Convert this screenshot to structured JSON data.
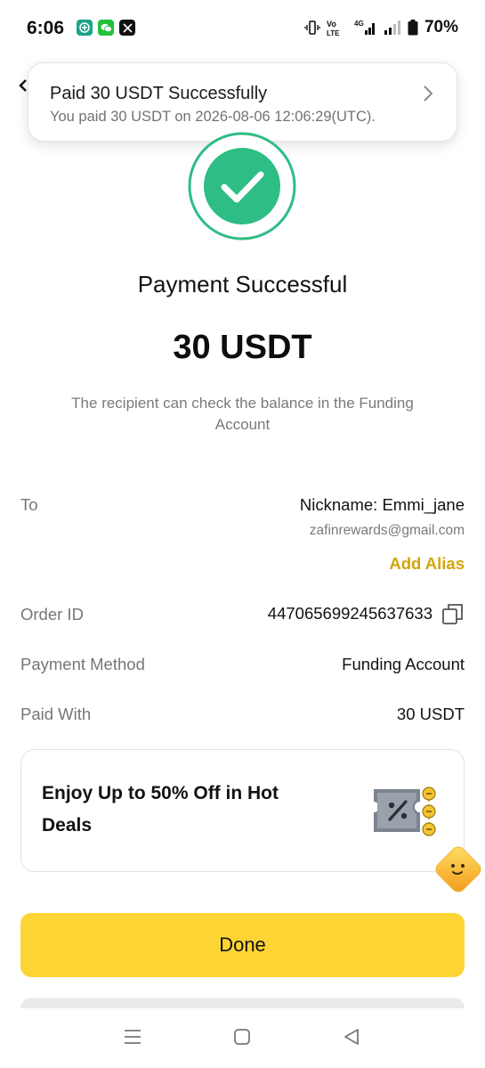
{
  "status_bar": {
    "time": "6:06",
    "battery": "70%",
    "network": "4G",
    "volte": "Vo LTE",
    "app_icons": [
      "plus-app-icon",
      "wechat-icon",
      "x-icon"
    ]
  },
  "toast": {
    "title": "Paid 30 USDT Successfully",
    "subtitle": "You paid 30 USDT on 2026-08-06 12:06:29(UTC)."
  },
  "result": {
    "title": "Payment Successful",
    "amount": "30 USDT",
    "note": "The recipient can check the balance in the Funding Account"
  },
  "details": {
    "to_label": "To",
    "nickname": "Nickname: Emmi_jane",
    "email": "zafinrewards@gmail.com",
    "add_alias": "Add Alias",
    "order_id_label": "Order ID",
    "order_id": "447065699245637633",
    "payment_method_label": "Payment Method",
    "payment_method": "Funding Account",
    "paid_with_label": "Paid With",
    "paid_with": "30 USDT"
  },
  "promo": {
    "text": "Enjoy Up to 50% Off in Hot Deals"
  },
  "actions": {
    "done": "Done"
  },
  "colors": {
    "accent_yellow": "#fcd535",
    "success_green": "#2ebd85",
    "alias_gold": "#d4a40a"
  }
}
